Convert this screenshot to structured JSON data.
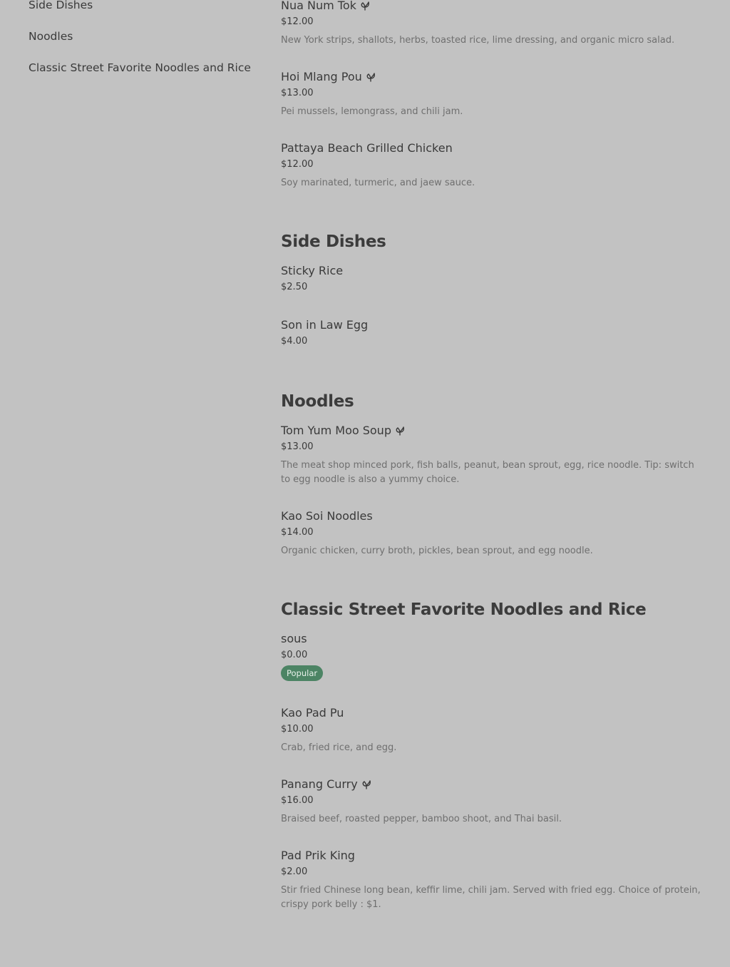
{
  "nav": {
    "items": [
      {
        "label": "Side Dishes"
      },
      {
        "label": "Noodles"
      },
      {
        "label": "Classic Street Favorite Noodles and Rice"
      }
    ]
  },
  "icons": {
    "leaf": "leaf-icon",
    "leaf_color": "#3a3a3a"
  },
  "colors": {
    "badge_bg": "#4c8464",
    "page_bg": "#c2c2c2"
  },
  "previous_section": {
    "items": [
      {
        "name": "Nua Num Tok",
        "leaf": true,
        "price": "$12.00",
        "description": "New York strips, shallots, herbs, toasted rice, lime dressing, and organic micro salad."
      },
      {
        "name": "Hoi Mlang Pou",
        "leaf": true,
        "price": "$13.00",
        "description": "Pei mussels, lemongrass, and chili jam."
      },
      {
        "name": "Pattaya Beach Grilled Chicken",
        "leaf": false,
        "price": "$12.00",
        "description": "Soy marinated, turmeric, and jaew sauce."
      }
    ]
  },
  "side_dishes": {
    "title": "Side Dishes",
    "items": [
      {
        "name": "Sticky Rice",
        "price": "$2.50"
      },
      {
        "name": "Son in Law Egg",
        "price": "$4.00"
      }
    ]
  },
  "noodles": {
    "title": "Noodles",
    "items": [
      {
        "name": "Tom Yum Moo Soup",
        "leaf": true,
        "price": "$13.00",
        "description": "The meat shop minced pork, fish balls, peanut, bean sprout, egg, rice noodle. Tip: switch to egg noodle is also a yummy choice."
      },
      {
        "name": "Kao Soi Noodles",
        "leaf": false,
        "price": "$14.00",
        "description": "Organic chicken, curry broth, pickles, bean sprout, and egg noodle."
      }
    ]
  },
  "classic": {
    "title": "Classic Street Favorite Noodles and Rice",
    "items": [
      {
        "name": "sous",
        "leaf": false,
        "price": "$0.00",
        "badge": "Popular"
      },
      {
        "name": "Kao Pad Pu",
        "leaf": false,
        "price": "$10.00",
        "description": "Crab, fried rice, and egg."
      },
      {
        "name": "Panang Curry",
        "leaf": true,
        "price": "$16.00",
        "description": "Braised beef, roasted pepper, bamboo shoot, and Thai basil."
      },
      {
        "name": "Pad Prik King",
        "leaf": false,
        "price": "$2.00",
        "description": "Stir fried Chinese long bean, keffir lime, chili jam. Served with fried egg. Choice of protein, crispy pork belly : $1."
      }
    ]
  }
}
